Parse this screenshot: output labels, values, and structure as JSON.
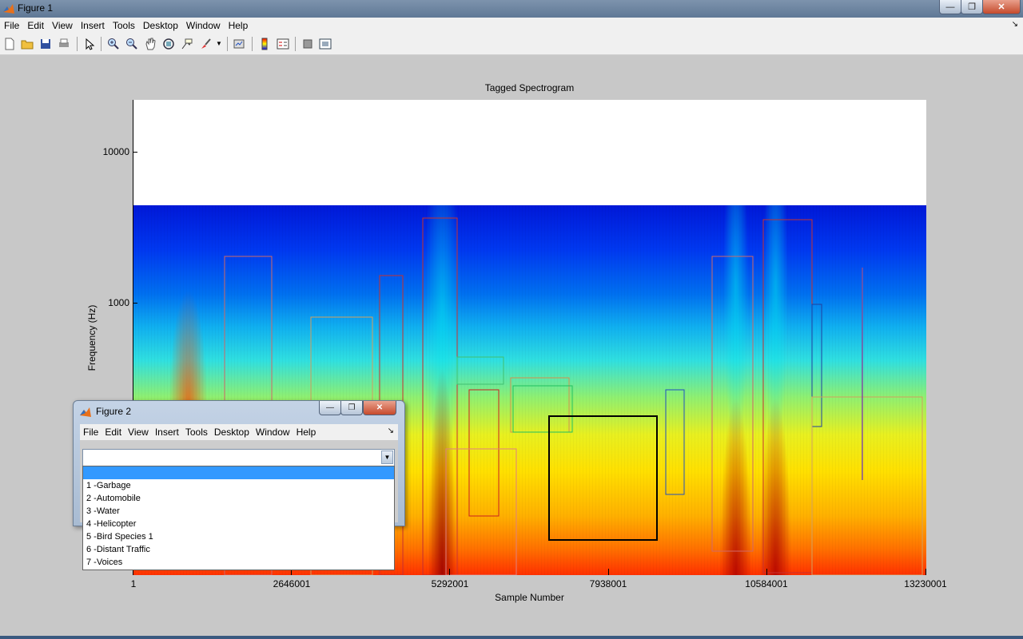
{
  "window": {
    "title": "Figure 1",
    "menu": [
      "File",
      "Edit",
      "View",
      "Insert",
      "Tools",
      "Desktop",
      "Window",
      "Help"
    ]
  },
  "toolbar": {
    "icons": [
      "new-figure-icon",
      "open-file-icon",
      "save-icon",
      "print-icon",
      "pointer-icon",
      "zoom-in-icon",
      "zoom-out-icon",
      "pan-icon",
      "rotate-3d-icon",
      "data-cursor-icon",
      "brush-icon",
      "brush-menu-icon",
      "link-plot-icon",
      "colorbar-icon",
      "legend-icon",
      "hide-plot-tools-icon",
      "show-plot-tools-icon"
    ]
  },
  "plot": {
    "title": "Tagged Spectrogram",
    "ylabel": "Frequency (Hz)",
    "xlabel": "Sample Number",
    "yticks": [
      "10000",
      "1000"
    ],
    "xticks": [
      "1",
      "2646001",
      "5292001",
      "7938001",
      "10584001",
      "13230001"
    ]
  },
  "chart_data": {
    "type": "heatmap",
    "title": "Tagged Spectrogram",
    "xlabel": "Sample Number",
    "ylabel": "Frequency (Hz)",
    "xlim": [
      1,
      13230001
    ],
    "yscale": "log",
    "ytick_labels": [
      "1000",
      "10000"
    ],
    "xtick_labels": [
      "1",
      "2646001",
      "5292001",
      "7938001",
      "10584001",
      "13230001"
    ],
    "colormap": "jet"
  },
  "figure2": {
    "title": "Figure 2",
    "menu": [
      "File",
      "Edit",
      "View",
      "Insert",
      "Tools",
      "Desktop",
      "Window",
      "Help"
    ],
    "select_value": "",
    "options": [
      "",
      "1 -Garbage",
      "2 -Automobile",
      "3 -Water",
      "4 -Helicopter",
      "5 -Bird Species 1",
      "6 -Distant Traffic",
      "7 -Voices"
    ]
  }
}
